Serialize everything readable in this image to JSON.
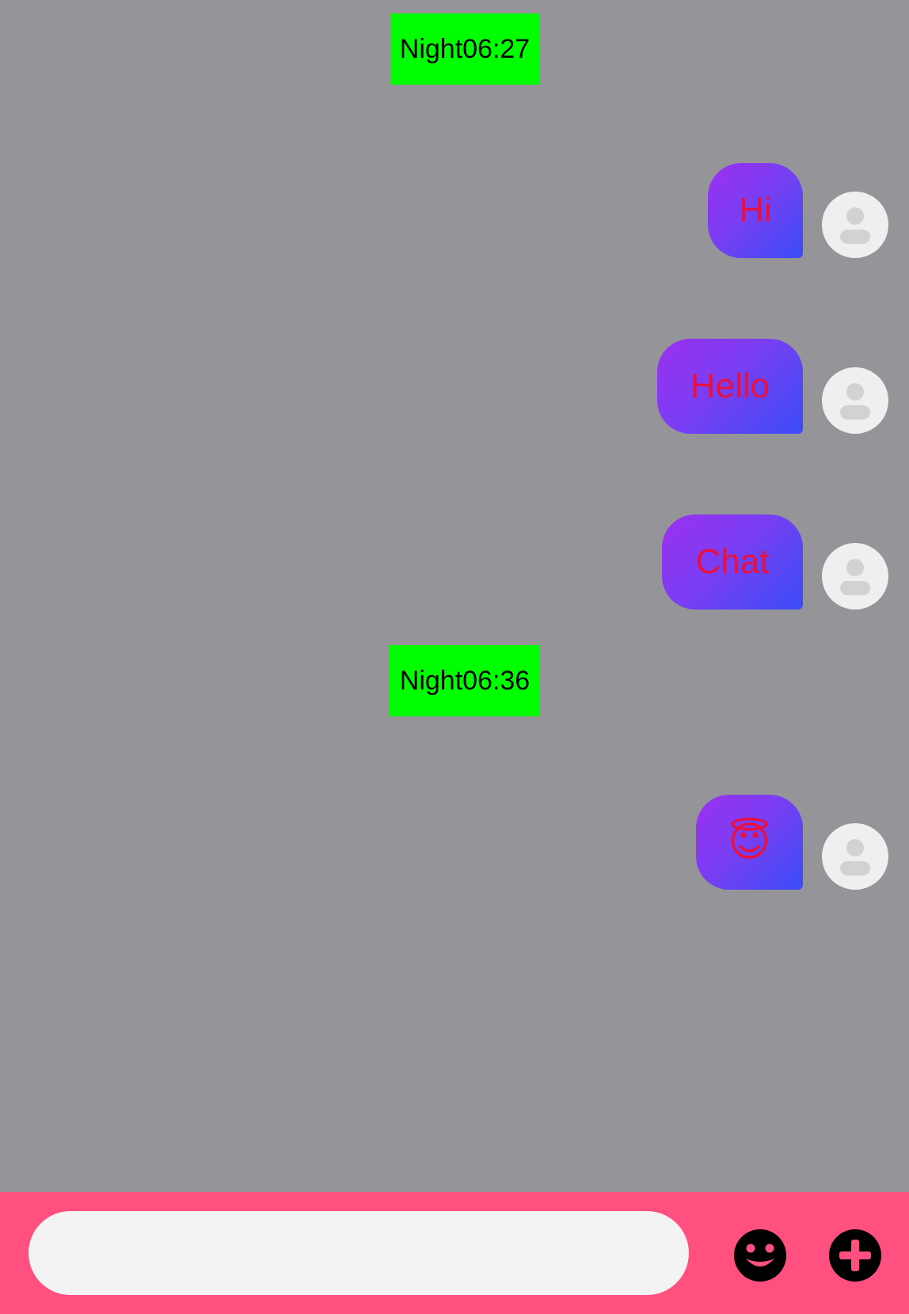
{
  "chat": {
    "timestamps": [
      "Night06:27",
      "Night06:36"
    ],
    "messages": [
      {
        "text": "Hi",
        "sender": "me"
      },
      {
        "text": "Hello",
        "sender": "me"
      },
      {
        "text": "Chat",
        "sender": "me"
      },
      {
        "text": "😇",
        "sender": "me"
      }
    ]
  },
  "composer": {
    "input_value": "",
    "input_placeholder": "",
    "emoji_icon": "smiley-face-icon",
    "plus_icon": "plus-circle-icon"
  },
  "colors": {
    "background": "#959499",
    "timestamp_bg": "#00ff00",
    "bubble_gradient_start": "#9b30f0",
    "bubble_gradient_end": "#3a4df7",
    "bubble_text": "#e8103f",
    "bottom_bar": "#ff507f",
    "avatar_bg": "#efefef"
  }
}
